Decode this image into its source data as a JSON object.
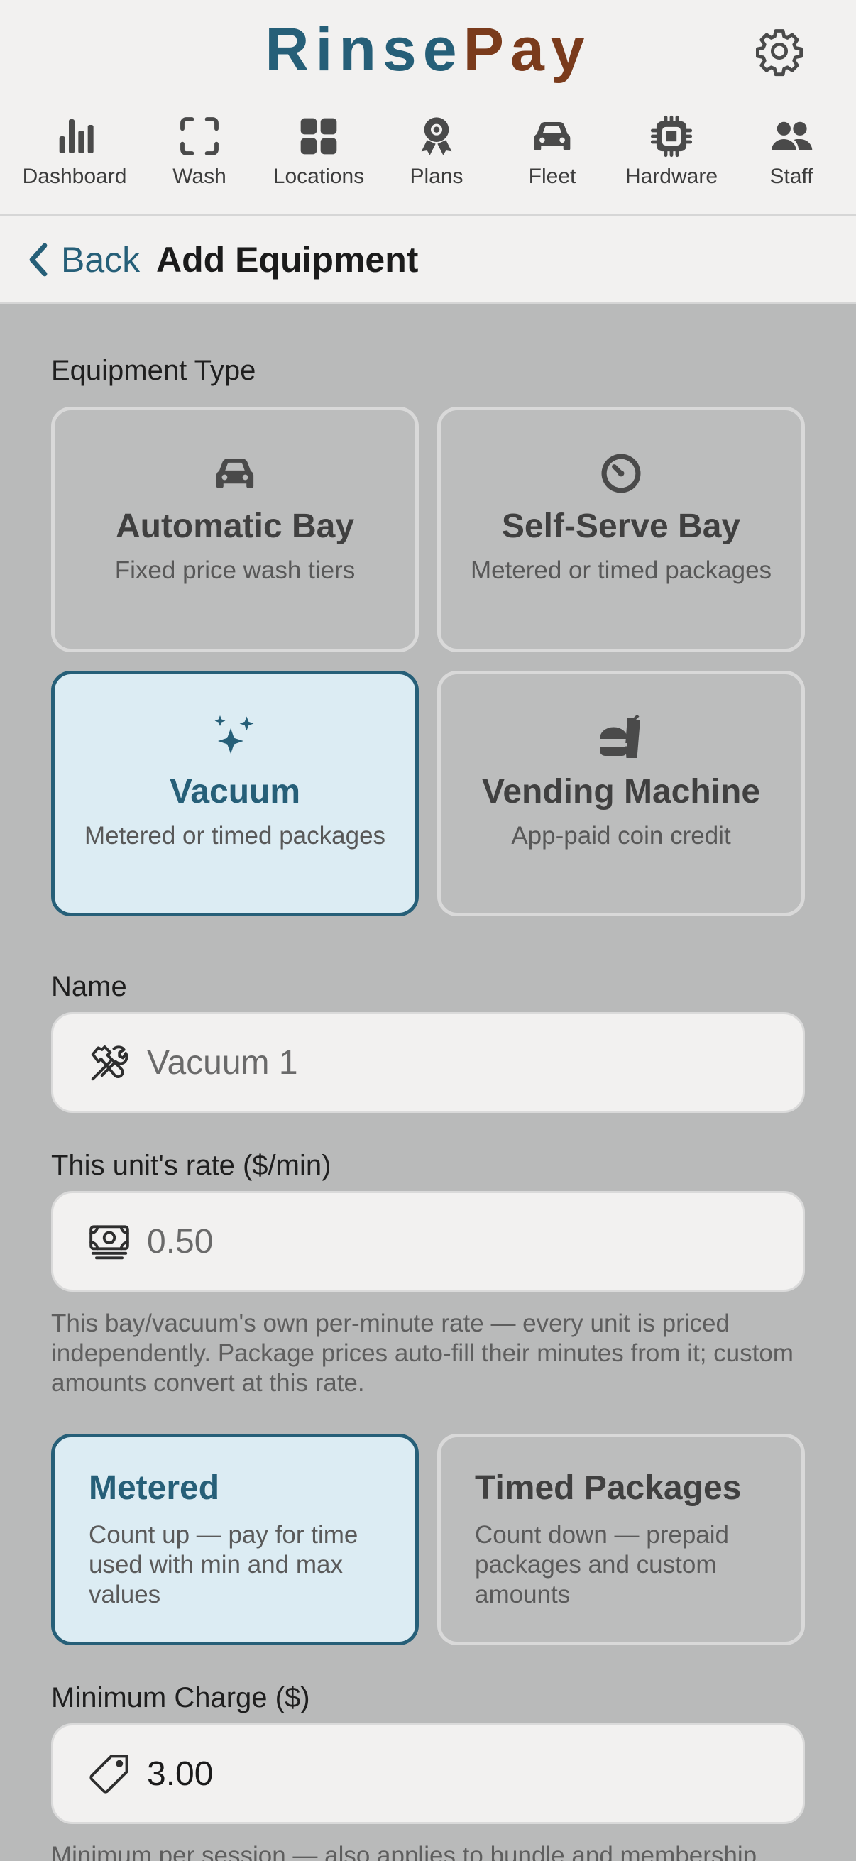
{
  "brand": {
    "part1": "Rinse",
    "part2": "Pay"
  },
  "nav": [
    {
      "label": "Dashboard",
      "icon": "bar-chart-icon"
    },
    {
      "label": "Wash",
      "icon": "scan-frame-icon"
    },
    {
      "label": "Locations",
      "icon": "grid-icon"
    },
    {
      "label": "Plans",
      "icon": "award-ribbon-icon"
    },
    {
      "label": "Fleet",
      "icon": "car-icon"
    },
    {
      "label": "Hardware",
      "icon": "chip-icon"
    },
    {
      "label": "Staff",
      "icon": "users-icon"
    }
  ],
  "header": {
    "back_label": "Back",
    "title": "Add Equipment"
  },
  "equipment_type": {
    "label": "Equipment Type",
    "options": [
      {
        "title": "Automatic Bay",
        "subtitle": "Fixed price wash tiers",
        "icon": "car-icon",
        "selected": false
      },
      {
        "title": "Self-Serve Bay",
        "subtitle": "Metered or timed packages",
        "icon": "timer-icon",
        "selected": false
      },
      {
        "title": "Vacuum",
        "subtitle": "Metered or timed packages",
        "icon": "sparkles-icon",
        "selected": true
      },
      {
        "title": "Vending Machine",
        "subtitle": "App-paid coin credit",
        "icon": "food-drink-icon",
        "selected": false
      }
    ]
  },
  "name_field": {
    "label": "Name",
    "placeholder": "Vacuum 1",
    "value": ""
  },
  "rate_field": {
    "label": "This unit's rate ($/min)",
    "placeholder": "0.50",
    "value": "",
    "help": "This bay/vacuum's own per-minute rate — every unit is priced independently. Package prices auto-fill their minutes from it; custom amounts convert at this rate."
  },
  "pricing_mode": [
    {
      "title": "Metered",
      "subtitle": "Count up — pay for time used with min and max values",
      "selected": true
    },
    {
      "title": "Timed Packages",
      "subtitle": "Count down — prepaid packages and custom amounts",
      "selected": false
    }
  ],
  "min_charge_field": {
    "label": "Minimum Charge ($)",
    "value": "3.00",
    "help": "Minimum per session — also applies to bundle and membership"
  },
  "colors": {
    "accent": "#265f78",
    "brand_secondary": "#7a3b1c",
    "selected_bg": "#dcecf3",
    "page_bg": "#b9baba"
  }
}
